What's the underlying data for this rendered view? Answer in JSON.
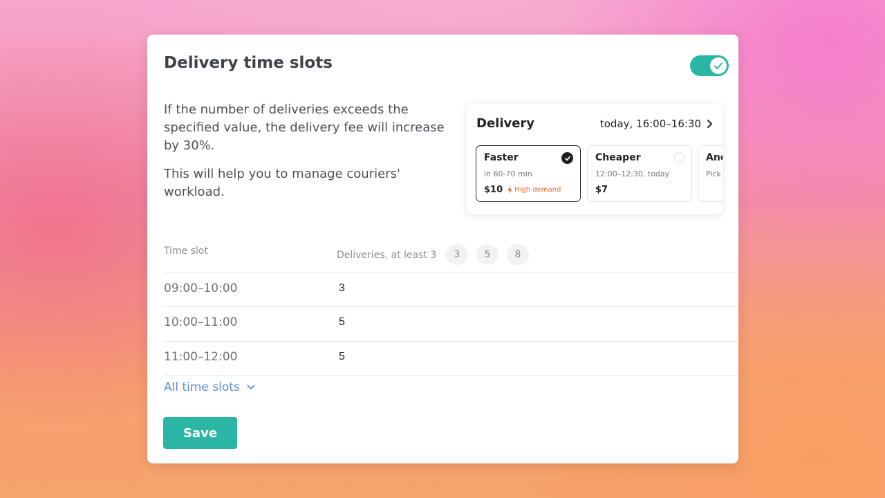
{
  "card": {
    "title": "Delivery time slots",
    "toggle_on": true,
    "description": [
      "If the number of deliveries exceeds the specified value, the delivery fee will increase by 30%.",
      "This will help you to manage couriers' workload."
    ]
  },
  "preview": {
    "title": "Delivery",
    "time": "today, 16:00–16:30",
    "options": [
      {
        "name": "Faster",
        "sub": "in 60-70 min",
        "price": "$10",
        "badge": "High demand",
        "selected": true
      },
      {
        "name": "Cheaper",
        "sub": "12:00–12:30, today",
        "price": "$7",
        "selected": false
      },
      {
        "name": "Anc",
        "sub": "Pick",
        "selected": false
      }
    ]
  },
  "table": {
    "col_time": "Time slot",
    "col_deliveries": "Deliveries, at least 3",
    "chips": [
      "3",
      "5",
      "8"
    ],
    "rows": [
      {
        "slot": "09:00–10:00",
        "value": "3"
      },
      {
        "slot": "10:00–11:00",
        "value": "5"
      },
      {
        "slot": "11:00–12:00",
        "value": "5"
      }
    ]
  },
  "all_slots_label": "All time slots",
  "save_label": "Save",
  "colors": {
    "accent": "#2bb5a4",
    "link": "#5b8fc9",
    "demand": "#ee6a35"
  }
}
